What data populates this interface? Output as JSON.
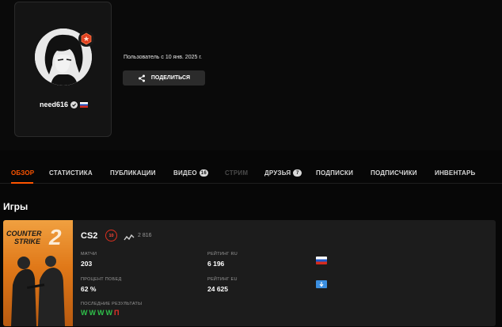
{
  "profile": {
    "nickname": "need616",
    "member_since": "Пользователь с 10 янв. 2025 г.",
    "share_label": "ПОДЕЛИТЬСЯ"
  },
  "tabs": [
    {
      "label": "ОБЗОР",
      "state": "active"
    },
    {
      "label": "СТАТИСТИКА",
      "state": "normal"
    },
    {
      "label": "ПУБЛИКАЦИИ",
      "state": "normal"
    },
    {
      "label": "ВИДЕО",
      "state": "normal",
      "count": "16"
    },
    {
      "label": "СТРИМ",
      "state": "disabled"
    },
    {
      "label": "ДРУЗЬЯ",
      "state": "normal",
      "count": "7"
    },
    {
      "label": "ПОДПИСКИ",
      "state": "normal"
    },
    {
      "label": "ПОДПИСЧИКИ",
      "state": "normal"
    },
    {
      "label": "ИНВЕНТАРЬ",
      "state": "normal"
    }
  ],
  "games_section": {
    "title": "Игры",
    "game": {
      "cover_logo_line1": "COUNTER",
      "cover_logo_line2": "STRIKE",
      "cover_logo_number": "2",
      "name": "CS2",
      "skill_level": "10",
      "elo": "2 816",
      "matches_label": "МАТЧИ",
      "matches_value": "203",
      "rating_ru_label": "РЕЙТИНГ RU",
      "rating_ru_value": "6 196",
      "winrate_label": "ПРОЦЕНТ ПОБЕД",
      "winrate_value": "62 %",
      "rating_eu_label": "РЕЙТИНГ EU",
      "rating_eu_value": "24 625",
      "recent_label": "ПОСЛЕДНИЕ РЕЗУЛЬТАТЫ",
      "recent_results": [
        "W",
        "W",
        "W",
        "W",
        "П"
      ]
    }
  },
  "colors": {
    "accent": "#ff5500",
    "win": "#2fc04a",
    "loss": "#e8332a"
  }
}
